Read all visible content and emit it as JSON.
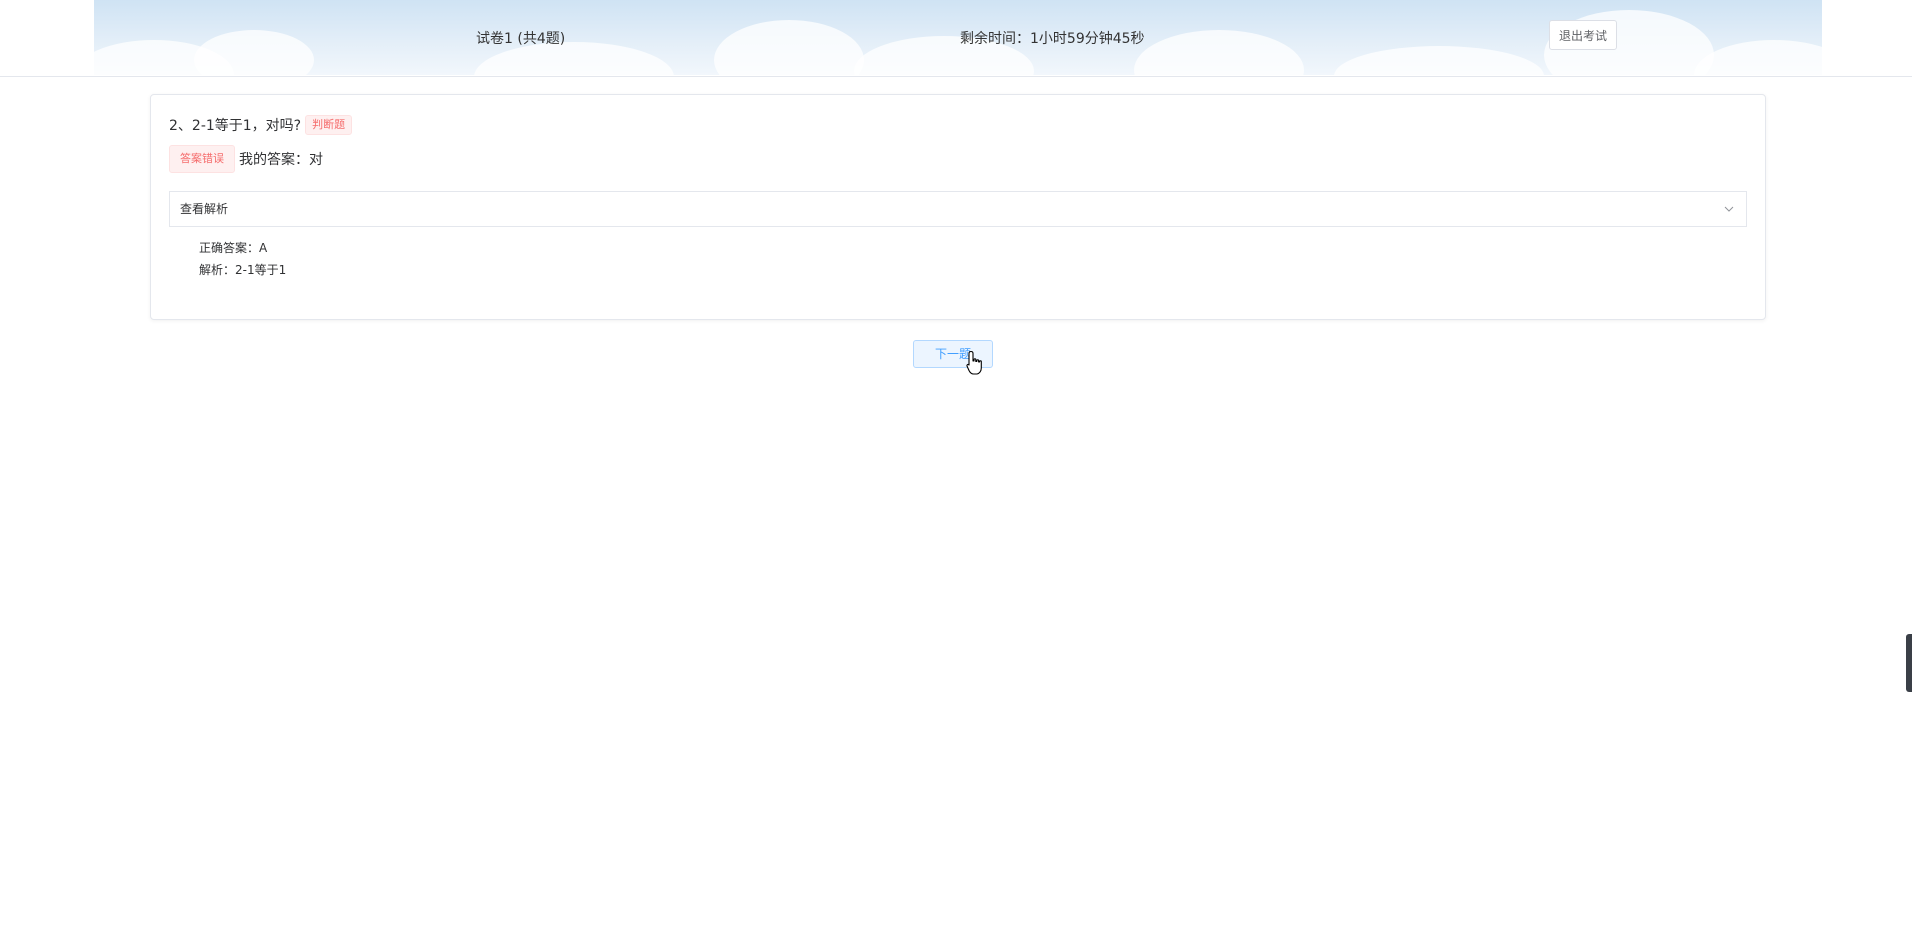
{
  "header": {
    "paper_title": "试卷1 (共4题)",
    "time_label": "剩余时间：",
    "time_value": "1小时59分钟45秒",
    "exit_label": "退出考试"
  },
  "question": {
    "text": "2、2-1等于1，对吗?",
    "type_tag": "判断题",
    "result_tag": "答案错误",
    "my_answer_label": "我的答案：",
    "my_answer_value": "对"
  },
  "analysis": {
    "toggle_label": "查看解析",
    "correct_label": "正确答案：",
    "correct_value": "A",
    "explain_label": "解析：",
    "explain_value": "2-1等于1"
  },
  "nav": {
    "next_label": "下一题"
  },
  "colors": {
    "primary": "#409eff",
    "danger": "#f56c6c",
    "header_sky": "#cfe3f4"
  }
}
